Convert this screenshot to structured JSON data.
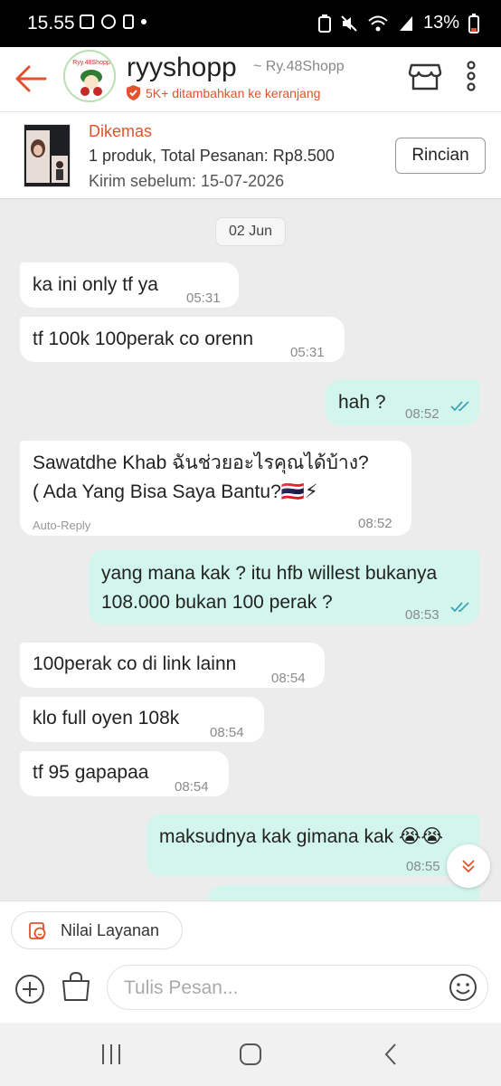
{
  "status_bar": {
    "time": "15.55",
    "battery": "13%"
  },
  "header": {
    "shop_name": "ryyshopp",
    "shop_alias": "~ Ry.48Shopp",
    "badge": "5K+ ditambahkan ke keranjang",
    "avatar_text": "Ryy.48Shopp"
  },
  "order": {
    "status": "Dikemas",
    "summary": "1 produk, Total Pesanan: Rp8.500",
    "ship_before": "Kirim sebelum: 15-07-2026",
    "details_button": "Rincian"
  },
  "chat": {
    "date": "02 Jun",
    "messages": [
      {
        "dir": "in",
        "lines": [
          "ka ini only tf ya"
        ],
        "time": "05:31"
      },
      {
        "dir": "in",
        "lines": [
          "tf 100k 100perak co orenn"
        ],
        "time": "05:31"
      },
      {
        "dir": "out",
        "lines": [
          "hah ?"
        ],
        "time": "08:52",
        "read": true
      },
      {
        "dir": "in",
        "lines": [
          "Sawatdhe Khab ฉันช่วยอะไรคุณได้บ้าง?",
          "( Ada Yang Bisa Saya Bantu?🇹🇭⚡"
        ],
        "time": "08:52",
        "tag": "Auto-Reply"
      },
      {
        "dir": "out",
        "lines": [
          "yang mana kak ? itu hfb willest bukanya",
          "108.000 bukan 100 perak ?"
        ],
        "time": "08:53",
        "read": true
      },
      {
        "dir": "in",
        "lines": [
          "100perak co di link lainn"
        ],
        "time": "08:54"
      },
      {
        "dir": "in",
        "lines": [
          "klo full oyen 108k"
        ],
        "time": "08:54"
      },
      {
        "dir": "in",
        "lines": [
          "tf 95 gapapaa"
        ],
        "time": "08:54"
      },
      {
        "dir": "out",
        "lines": [
          "maksudnya kak gimana kak 😭😭"
        ],
        "time": "08:55"
      }
    ]
  },
  "composer": {
    "rate_button": "Nilai Layanan",
    "input_placeholder": "Tulis Pesan..."
  },
  "colors": {
    "accent": "#e0532c",
    "outgoing_bubble": "#d2f5ec",
    "read_ticks": "#3aa5b8"
  }
}
